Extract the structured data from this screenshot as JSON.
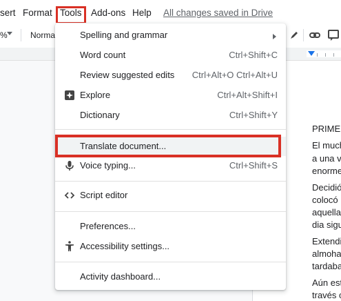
{
  "menubar": {
    "items": [
      {
        "label": "sert"
      },
      {
        "label": "Format"
      },
      {
        "label": "Tools"
      },
      {
        "label": "Add-ons"
      },
      {
        "label": "Help"
      }
    ],
    "saved_status": "All changes saved in Drive"
  },
  "toolbar": {
    "zoom_fragment": "%",
    "style_fragment": "Normal"
  },
  "tools_menu": {
    "items": [
      {
        "label": "Spelling and grammar",
        "shortcut": "",
        "icon": "",
        "submenu": true
      },
      {
        "label": "Word count",
        "shortcut": "Ctrl+Shift+C",
        "icon": ""
      },
      {
        "label": "Review suggested edits",
        "shortcut": "Ctrl+Alt+O Ctrl+Alt+U",
        "icon": ""
      },
      {
        "label": "Explore",
        "shortcut": "Ctrl+Alt+Shift+I",
        "icon": "explore-icon"
      },
      {
        "label": "Dictionary",
        "shortcut": "Ctrl+Shift+Y",
        "icon": ""
      },
      {
        "label": "Translate document...",
        "shortcut": "",
        "icon": ""
      },
      {
        "label": "Voice typing...",
        "shortcut": "Ctrl+Shift+S",
        "icon": "microphone-icon"
      },
      {
        "label": "Script editor",
        "shortcut": "",
        "icon": "code-icon"
      },
      {
        "label": "Preferences...",
        "shortcut": "",
        "icon": ""
      },
      {
        "label": "Accessibility settings...",
        "shortcut": "",
        "icon": "accessibility-icon"
      },
      {
        "label": "Activity dashboard...",
        "shortcut": "",
        "icon": ""
      }
    ]
  },
  "document": {
    "lines": [
      "PRIME",
      "El much",
      "a una v",
      "enormem",
      "Decidió",
      "colocó",
      "aquella",
      "dia sigu",
      "Extendi",
      "almoha",
      "tardaba",
      "Aún est",
      "través c"
    ]
  },
  "colors": {
    "highlight_box": "#d93025",
    "ruler_marker": "#1a73e8"
  }
}
